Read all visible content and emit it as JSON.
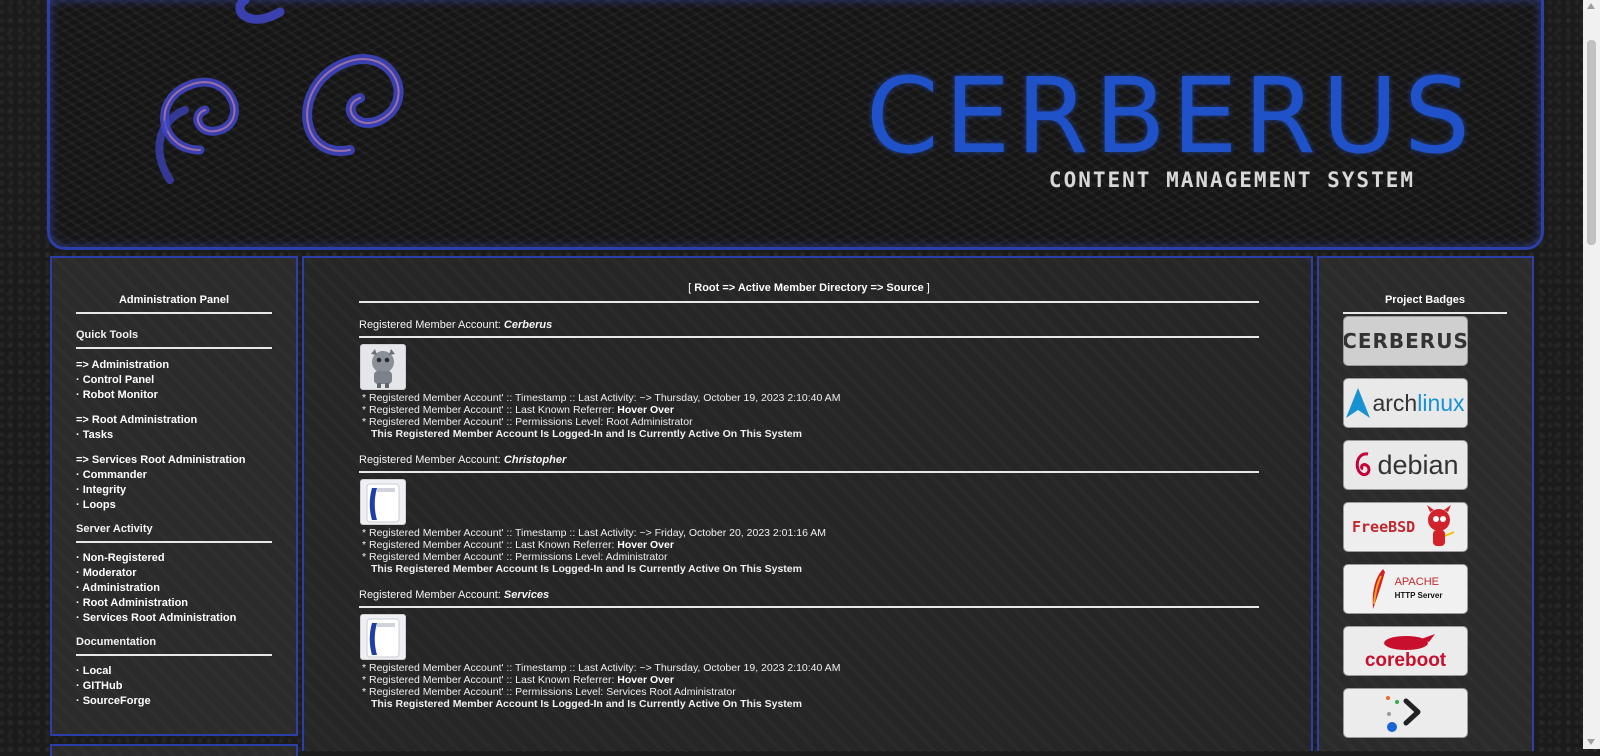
{
  "banner": {
    "title": "CERBERUS",
    "subtitle": "CONTENT MANAGEMENT SYSTEM"
  },
  "left_panel": {
    "title": "Administration Panel",
    "quick_tools": {
      "heading": "Quick Tools",
      "groups": [
        {
          "header": "=> Administration",
          "items": [
            "· Control Panel",
            "· Robot Monitor"
          ]
        },
        {
          "header": "=> Root Administration",
          "items": [
            "· Tasks"
          ]
        },
        {
          "header": "=> Services Root Administration",
          "items": [
            "· Commander",
            "· Integrity",
            "· Loops"
          ]
        }
      ]
    },
    "server_activity": {
      "heading": "Server Activity",
      "items": [
        "· Non-Registered",
        "· Moderator",
        "· Administration",
        "· Root Administration",
        "· Services Root Administration"
      ]
    },
    "documentation": {
      "heading": "Documentation",
      "items": [
        "· Local",
        "· GITHub",
        "· SourceForge"
      ]
    }
  },
  "main": {
    "breadcrumb": {
      "open": "[ ",
      "path": "Root => Active Member Directory => Source",
      "close": " ]"
    },
    "account_label": "Registered Member Account: ",
    "accounts": [
      {
        "name": "Cerberus",
        "activity": "* Registered Member Account' :: Timestamp :: Last Activity: ~> Thursday, October 19, 2023 2:10:40 AM",
        "referrer_label": "* Registered Member Account' :: Last Known Referrer: ",
        "referrer": "Hover Over",
        "permissions": "* Registered Member Account' :: Permissions Level: Root Administrator",
        "status": "This Registered Member Account Is Logged-In and Is Currently Active On This System"
      },
      {
        "name": "Christopher",
        "activity": "* Registered Member Account' :: Timestamp :: Last Activity: ~> Friday, October 20, 2023 2:01:16 AM",
        "referrer_label": "* Registered Member Account' :: Last Known Referrer: ",
        "referrer": "Hover Over",
        "permissions": "* Registered Member Account' :: Permissions Level: Administrator",
        "status": "This Registered Member Account Is Logged-In and Is Currently Active On This System"
      },
      {
        "name": "Services",
        "activity": "* Registered Member Account' :: Timestamp :: Last Activity: ~> Thursday, October 19, 2023 2:10:40 AM",
        "referrer_label": "* Registered Member Account' :: Last Known Referrer: ",
        "referrer": "Hover Over",
        "permissions": "* Registered Member Account' :: Permissions Level: Services Root Administrator",
        "status": "This Registered Member Account Is Logged-In and Is Currently Active On This System"
      }
    ]
  },
  "right_panel": {
    "title": "Project Badges",
    "badges": [
      {
        "name": "cerberus",
        "text": "CERBERUS"
      },
      {
        "name": "archlinux",
        "text_a": "arch",
        "text_b": "linux"
      },
      {
        "name": "debian",
        "text": "debian"
      },
      {
        "name": "freebsd",
        "text": "FreeBSD"
      },
      {
        "name": "apache",
        "text_a": "APACHE",
        "text_b": "HTTP Server"
      },
      {
        "name": "coreboot",
        "text": "coreboot"
      },
      {
        "name": "terminal",
        "text": ""
      }
    ]
  },
  "colors": {
    "accent_blue": "#2c3fa8",
    "banner_title": "#1f52c9",
    "panel_bg": "#2b2b2b"
  }
}
